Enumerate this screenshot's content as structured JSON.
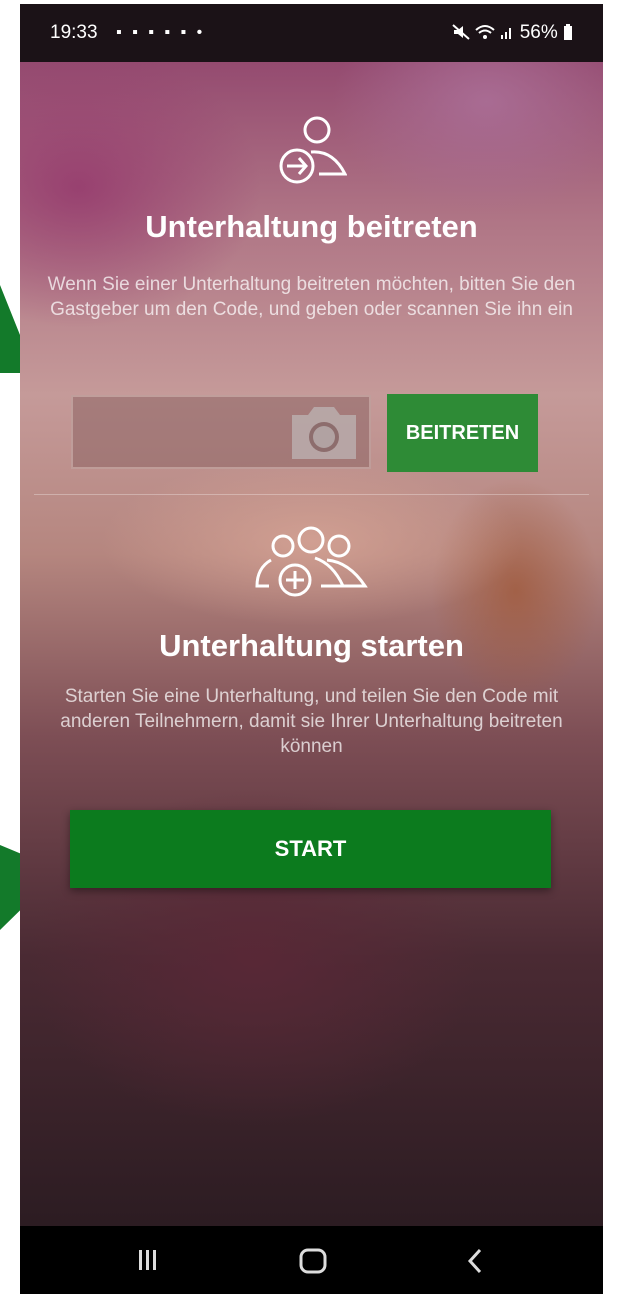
{
  "status_bar": {
    "time": "19:33",
    "notification_icons": "▪ ▪ ▪ ▪ ▪ •",
    "right": "56%"
  },
  "join": {
    "icon": "user-join-icon",
    "title": "Unterhaltung beitreten",
    "description": "Wenn Sie einer Unterhaltung beitreten möchten, bitten Sie den Gastgeber um den Code, und geben oder scannen Sie ihn ein",
    "code_value": "",
    "button_label": "BEITRETEN"
  },
  "start": {
    "icon": "group-add-icon",
    "title": "Unterhaltung starten",
    "description": "Starten Sie eine Unterhaltung, und teilen Sie den Code mit anderen Teilnehmern, damit sie Ihrer Unterhaltung beitreten können",
    "button_label": "START"
  },
  "colors": {
    "join_button": "#2e8b36",
    "start_button": "#0c7b1e",
    "annotation_arrow": "#137a2a"
  },
  "nav": [
    "recent-apps-icon",
    "home-icon",
    "back-icon"
  ]
}
